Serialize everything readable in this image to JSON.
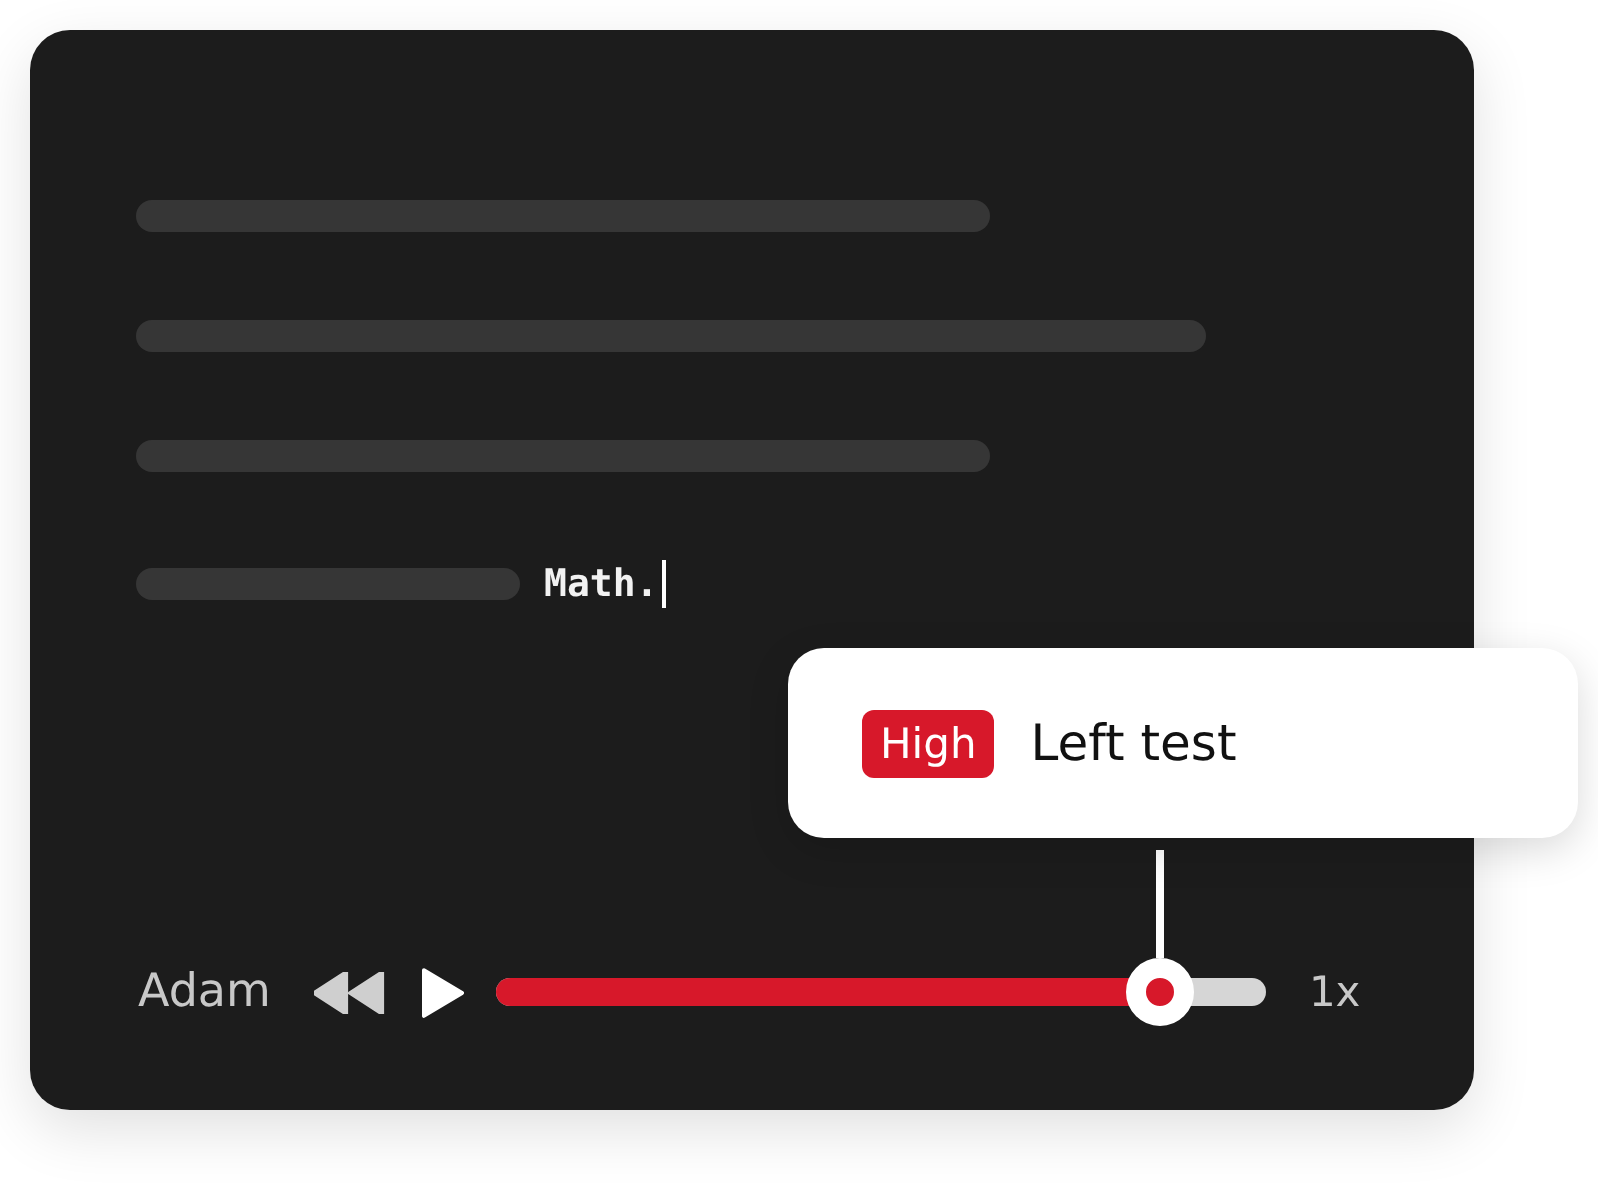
{
  "editor": {
    "typed_text": "Math."
  },
  "tooltip": {
    "badge": "High",
    "label": "Left test"
  },
  "player": {
    "speaker": "Adam",
    "progress": {
      "level": 0.86
    },
    "speed": "1x"
  }
}
